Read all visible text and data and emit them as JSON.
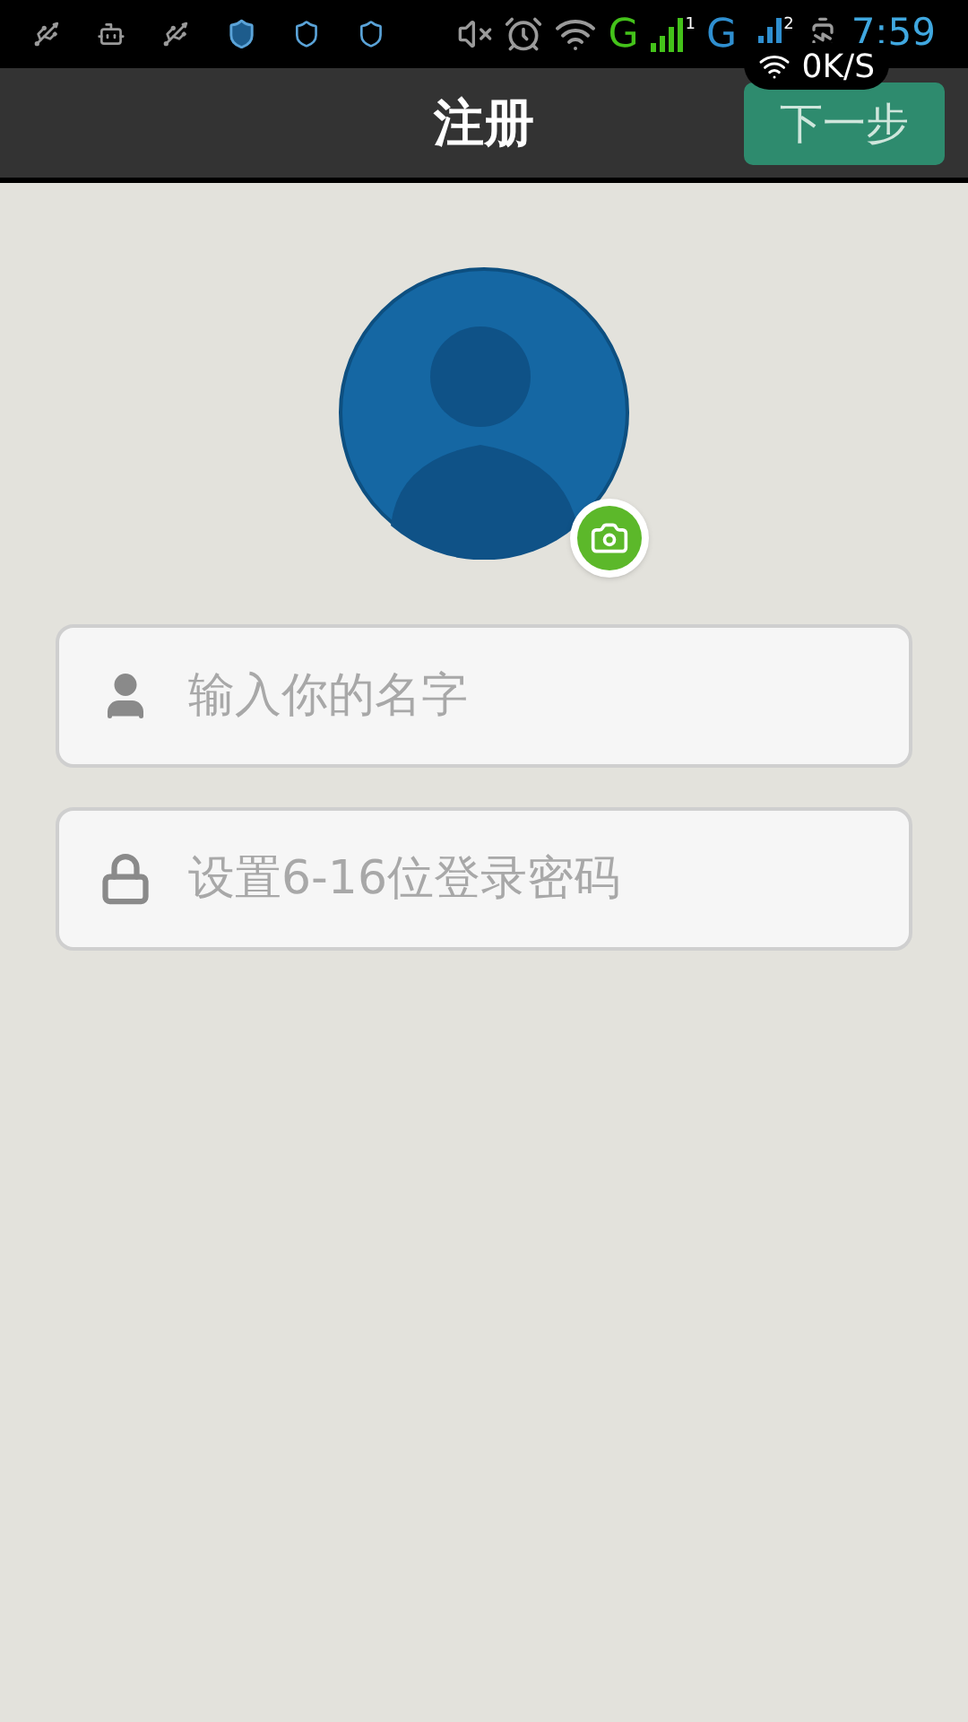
{
  "status_bar": {
    "network_1": "G",
    "sim_1": "1",
    "network_2": "G",
    "sim_2": "2",
    "time": "7:59",
    "speed": "0K/S"
  },
  "header": {
    "title": "注册",
    "next_button": "下一步"
  },
  "fields": [
    {
      "kind": "name",
      "placeholder": "输入你的名字"
    },
    {
      "kind": "password",
      "placeholder": "设置6-16位登录密码"
    }
  ]
}
